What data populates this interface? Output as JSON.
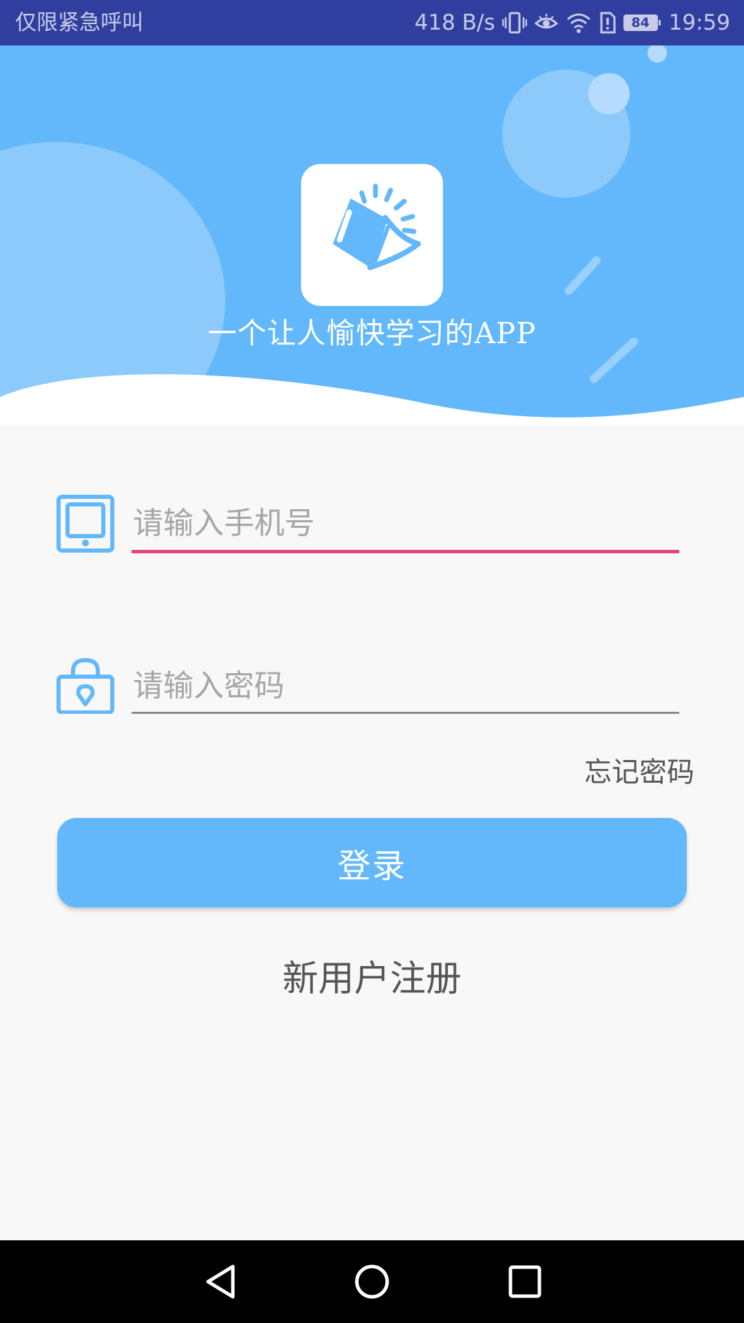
{
  "status_bar": {
    "carrier_text": "仅限紧急呼叫",
    "network_speed": "418 B/s",
    "battery_level": "84",
    "time": "19:59",
    "icons": [
      "vibrate-icon",
      "eye-comfort-icon",
      "wifi-icon",
      "alert-icon",
      "battery-icon"
    ]
  },
  "header": {
    "tagline": "一个让人愉快学习的APP",
    "background_color": "#62b8fb",
    "logo_icon": "book-icon"
  },
  "login_form": {
    "phone_placeholder": "请输入手机号",
    "phone_value": "",
    "phone_icon": "phone-icon",
    "password_placeholder": "请输入密码",
    "password_value": "",
    "password_icon": "lock-icon",
    "forgot_password": "忘记密码",
    "login_button": "登录",
    "register_link": "新用户注册",
    "accent_color": "#e9437c"
  },
  "nav_bar": {
    "back_icon": "back-triangle-icon",
    "home_icon": "home-circle-icon",
    "recents_icon": "recents-square-icon"
  }
}
